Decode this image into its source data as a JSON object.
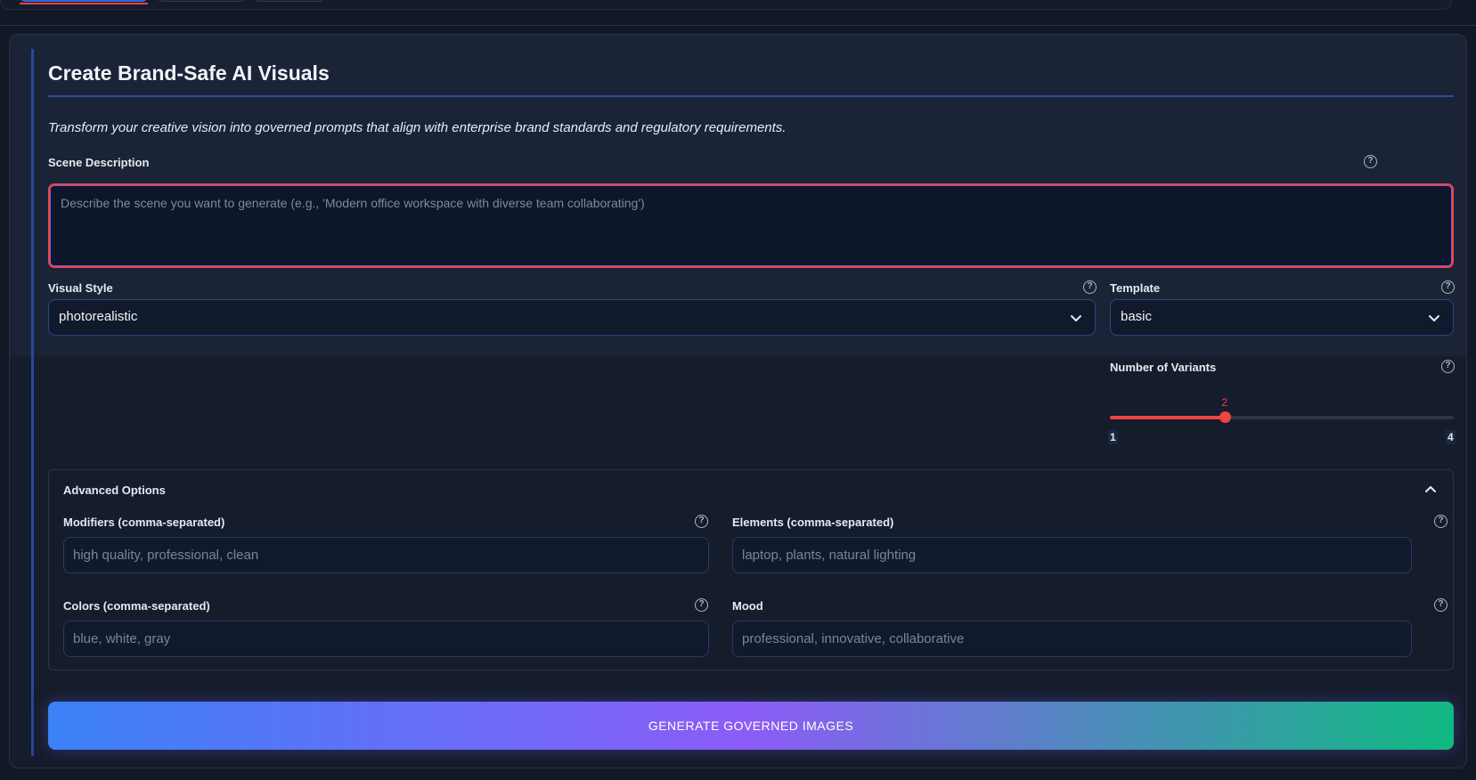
{
  "page": {
    "title": "Create Brand-Safe AI Visuals",
    "subtitle": "Transform your creative vision into governed prompts that align with enterprise brand standards and regulatory requirements."
  },
  "scene": {
    "label": "Scene Description",
    "placeholder": "Describe the scene you want to generate (e.g., 'Modern office workspace with diverse team collaborating')"
  },
  "visual_style": {
    "label": "Visual Style",
    "value": "photorealistic"
  },
  "template": {
    "label": "Template",
    "value": "basic"
  },
  "variants": {
    "label": "Number of Variants",
    "value": 2,
    "min": "1",
    "max": "4",
    "value_label": "2"
  },
  "advanced": {
    "title": "Advanced Options",
    "modifiers": {
      "label": "Modifiers (comma-separated)",
      "placeholder": "high quality, professional, clean"
    },
    "elements": {
      "label": "Elements (comma-separated)",
      "placeholder": "laptop, plants, natural lighting"
    },
    "colors": {
      "label": "Colors (comma-separated)",
      "placeholder": "blue, white, gray"
    },
    "mood": {
      "label": "Mood",
      "placeholder": "professional, innovative, collaborative"
    }
  },
  "generate": {
    "label": "GENERATE GOVERNED IMAGES"
  },
  "help_glyph": "?",
  "theme": {
    "accent": "#ef4444",
    "primary": "#3b82f6",
    "gradient_mid": "#8b5cf6",
    "gradient_end": "#10b981"
  }
}
